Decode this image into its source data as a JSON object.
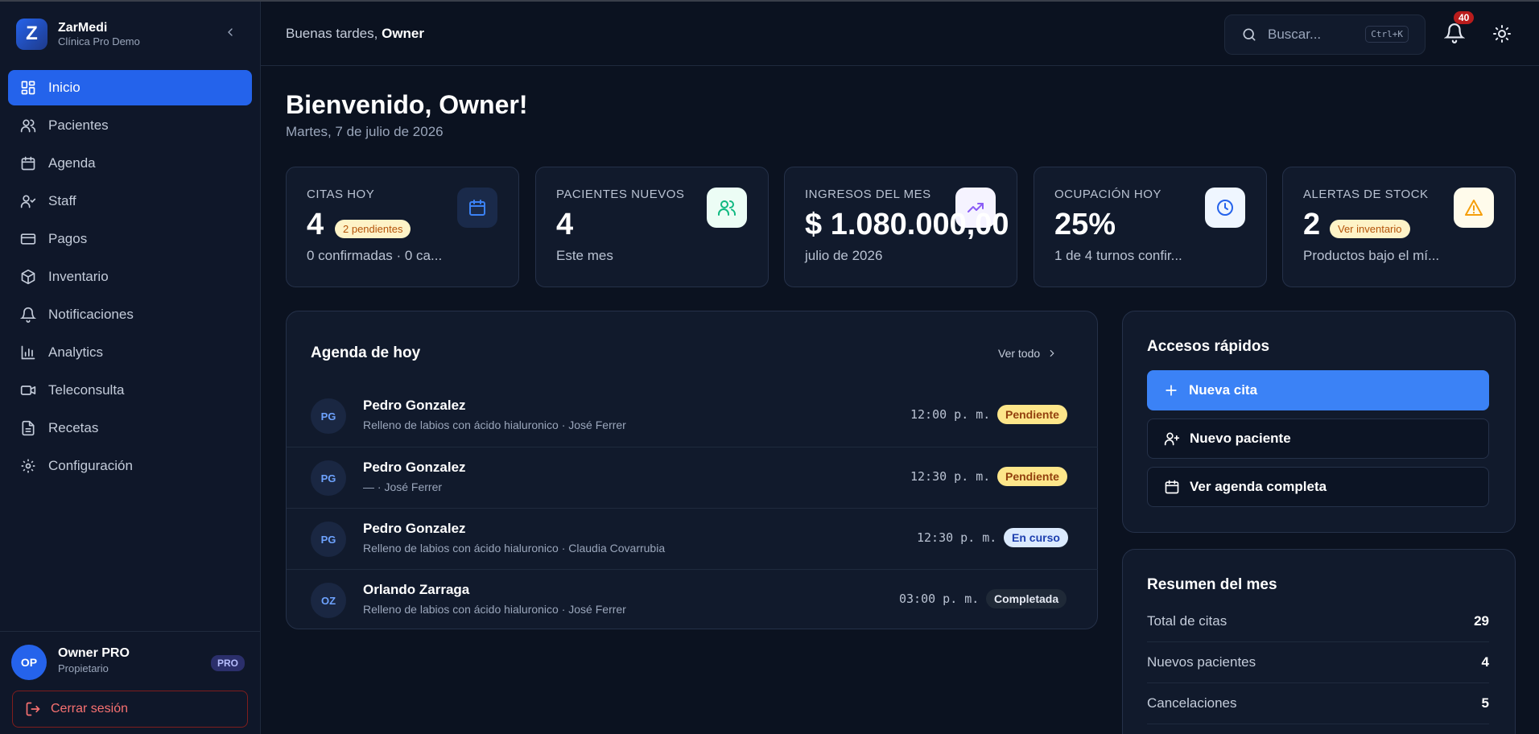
{
  "app": {
    "name": "ZarMedi",
    "subtitle": "Clínica Pro Demo",
    "logo_letter": "Z"
  },
  "sidebar": {
    "items": [
      {
        "label": "Inicio",
        "icon": "dashboard-icon",
        "active": true
      },
      {
        "label": "Pacientes",
        "icon": "users-icon"
      },
      {
        "label": "Agenda",
        "icon": "calendar-icon"
      },
      {
        "label": "Staff",
        "icon": "user-check-icon"
      },
      {
        "label": "Pagos",
        "icon": "credit-card-icon"
      },
      {
        "label": "Inventario",
        "icon": "box-icon"
      },
      {
        "label": "Notificaciones",
        "icon": "bell-icon"
      },
      {
        "label": "Analytics",
        "icon": "bar-chart-icon"
      },
      {
        "label": "Teleconsulta",
        "icon": "video-icon"
      },
      {
        "label": "Recetas",
        "icon": "file-text-icon"
      },
      {
        "label": "Configuración",
        "icon": "settings-icon"
      }
    ]
  },
  "user": {
    "initials": "OP",
    "name": "Owner PRO",
    "role": "Propietario",
    "badge": "PRO",
    "logout": "Cerrar sesión"
  },
  "header": {
    "greeting_prefix": "Buenas tardes,",
    "greeting_name": "Owner",
    "search_placeholder": "Buscar...",
    "search_shortcut": "Ctrl+K",
    "notification_count": "40"
  },
  "welcome": {
    "title": "Bienvenido, Owner!",
    "date": "Martes, 7 de julio de 2026"
  },
  "kpis": [
    {
      "label": "CITAS HOY",
      "value": "4",
      "pill": "2 pendientes",
      "sub": "0 confirmadas · 0 ca...",
      "icon": "calendar-icon"
    },
    {
      "label": "PACIENTES NUEVOS",
      "value": "4",
      "sub": "Este mes",
      "icon": "users-icon"
    },
    {
      "label": "INGRESOS DEL MES",
      "value": "$ 1.080.000,00",
      "sub": "julio de 2026",
      "icon": "trending-up-icon"
    },
    {
      "label": "OCUPACIÓN HOY",
      "value": "25%",
      "sub": "1 de 4 turnos confir...",
      "icon": "clock-icon"
    },
    {
      "label": "ALERTAS DE STOCK",
      "value": "2",
      "pill": "Ver inventario",
      "sub": "Productos bajo el mí...",
      "icon": "alert-triangle-icon"
    }
  ],
  "agenda": {
    "title": "Agenda de hoy",
    "view_all": "Ver todo",
    "rows": [
      {
        "initials": "PG",
        "name": "Pedro Gonzalez",
        "desc": "Relleno de labios con ácido hialuronico · José Ferrer",
        "time": "12:00 p. m.",
        "status": "Pendiente"
      },
      {
        "initials": "PG",
        "name": "Pedro Gonzalez",
        "desc": "— · José Ferrer",
        "time": "12:30 p. m.",
        "status": "Pendiente"
      },
      {
        "initials": "PG",
        "name": "Pedro Gonzalez",
        "desc": "Relleno de labios con ácido hialuronico · Claudia Covarrubia",
        "time": "12:30 p. m.",
        "status": "En curso"
      },
      {
        "initials": "OZ",
        "name": "Orlando Zarraga",
        "desc": "Relleno de labios con ácido hialuronico · José Ferrer",
        "time": "03:00 p. m.",
        "status": "Completada"
      }
    ]
  },
  "quick_access": {
    "title": "Accesos rápidos",
    "buttons": [
      {
        "label": "Nueva cita",
        "icon": "plus-icon"
      },
      {
        "label": "Nuevo paciente",
        "icon": "user-plus-icon"
      },
      {
        "label": "Ver agenda completa",
        "icon": "calendar-icon"
      }
    ]
  },
  "summary": {
    "title": "Resumen del mes",
    "rows": [
      {
        "label": "Total de citas",
        "value": "29"
      },
      {
        "label": "Nuevos pacientes",
        "value": "4"
      },
      {
        "label": "Cancelaciones",
        "value": "5"
      }
    ]
  },
  "colors": {
    "accent": "#2463eb",
    "pending": "#fde68a",
    "in_progress": "#dbeafe",
    "completed": "#1f2937",
    "danger": "#f87171"
  }
}
